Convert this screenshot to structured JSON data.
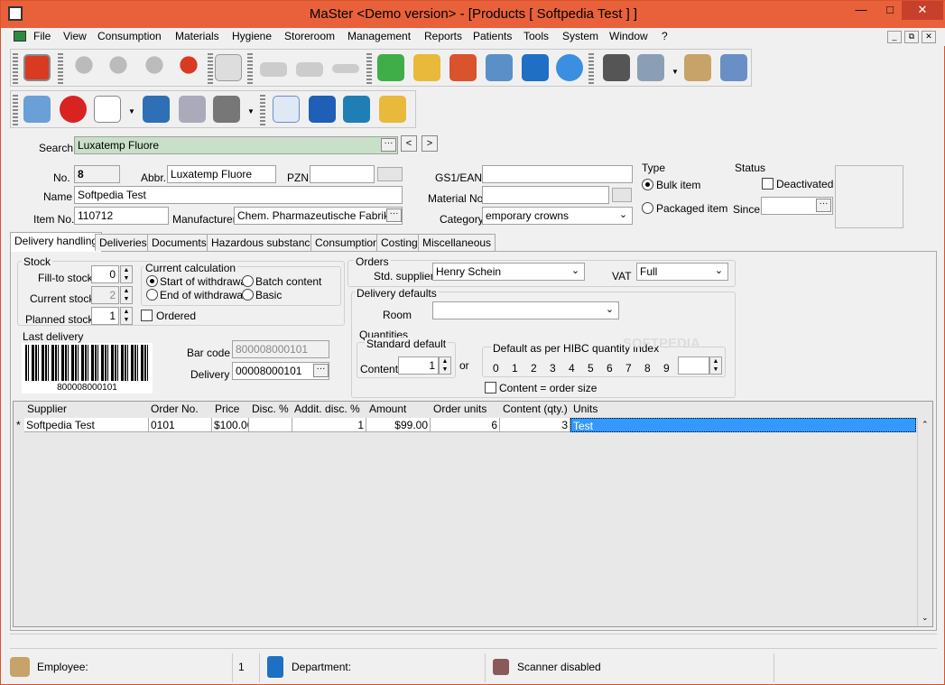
{
  "window": {
    "title": "MaSter <Demo version> - [Products [ Softpedia Test ] ]",
    "minimize": "—",
    "maximize": "□",
    "close": "✕"
  },
  "menu": [
    "File",
    "View",
    "Consumption",
    "Materials",
    "Hygiene",
    "Storeroom",
    "Management",
    "Reports",
    "Patients",
    "Tools",
    "System",
    "Window",
    "?"
  ],
  "mdi": {
    "min": "_",
    "restore": "⧉",
    "close": "✕"
  },
  "search": {
    "label": "Search",
    "value": "Luxatemp Fluore",
    "prev": "<",
    "next": ">"
  },
  "product": {
    "no_label": "No.",
    "no": "8",
    "abbr_label": "Abbr.",
    "abbr": "Luxatemp Fluore",
    "pzn_label": "PZN",
    "pzn": "",
    "name_label": "Name",
    "name": "Softpedia Test",
    "itemno_label": "Item No.",
    "itemno": "110712",
    "manufacturer_label": "Manufacturer",
    "manufacturer": "Chem. Pharmazeutische Fabrik Gm",
    "gs1_label": "GS1/EAN",
    "gs1": "",
    "material_label": "Material No.",
    "material": "",
    "category_label": "Category",
    "category": "emporary crowns",
    "type_label": "Type",
    "type_bulk": "Bulk item",
    "type_packaged": "Packaged item",
    "status_label": "Status",
    "deactivated": "Deactivated",
    "since_label": "Since",
    "since": ""
  },
  "tabs": [
    "Delivery handling",
    "Deliveries",
    "Documents",
    "Hazardous substance",
    "Consumption",
    "Costing",
    "Miscellaneous"
  ],
  "stock": {
    "label": "Stock",
    "fill_label": "Fill-to stock",
    "fill": "0",
    "current_label": "Current stock",
    "current": "2",
    "planned_label": "Planned stock",
    "planned": "1",
    "ordered": "Ordered"
  },
  "calc": {
    "label": "Current calculation",
    "start": "Start of withdrawal",
    "end": "End of withdrawal",
    "batch": "Batch content",
    "basic": "Basic"
  },
  "last_delivery": {
    "label": "Last delivery",
    "barcode_text": "800008000101",
    "barcode_label": "Bar code",
    "barcode_value": "800008000101",
    "delivery_label": "Delivery",
    "delivery_value": "00008000101"
  },
  "orders": {
    "label": "Orders",
    "supplier_label": "Std. supplier",
    "supplier": "Henry Schein",
    "vat_label": "VAT",
    "vat": "Full"
  },
  "delivery_defaults": {
    "label": "Delivery defaults",
    "room_label": "Room",
    "room": ""
  },
  "quantities": {
    "label": "Quantities",
    "std_label": "Standard default",
    "content_label": "Content",
    "content": "1",
    "or": "or",
    "hibc_label": "Default as per HIBC quantity index",
    "digits": [
      "0",
      "1",
      "2",
      "3",
      "4",
      "5",
      "6",
      "7",
      "8",
      "9"
    ],
    "content_eq": "Content = order size"
  },
  "grid": {
    "headers": [
      "Supplier",
      "Order No.",
      "Price",
      "Disc. %",
      "Addit. disc. %",
      "Amount",
      "Order units",
      "Content (qty.)",
      "Units"
    ],
    "row_marker": "*",
    "row": [
      "Softpedia Test",
      "0101",
      "$100.00",
      "",
      "1",
      "$99.00",
      "6",
      "3",
      "Test"
    ]
  },
  "statusbar": {
    "employee": "Employee:",
    "num": "1",
    "department": "Department:",
    "scanner": "Scanner disabled"
  },
  "watermark": "SOFTPEDIA",
  "colors": {
    "accent": "#e8613a",
    "selection": "#3399ff",
    "search_bg": "#c8e0c8"
  }
}
